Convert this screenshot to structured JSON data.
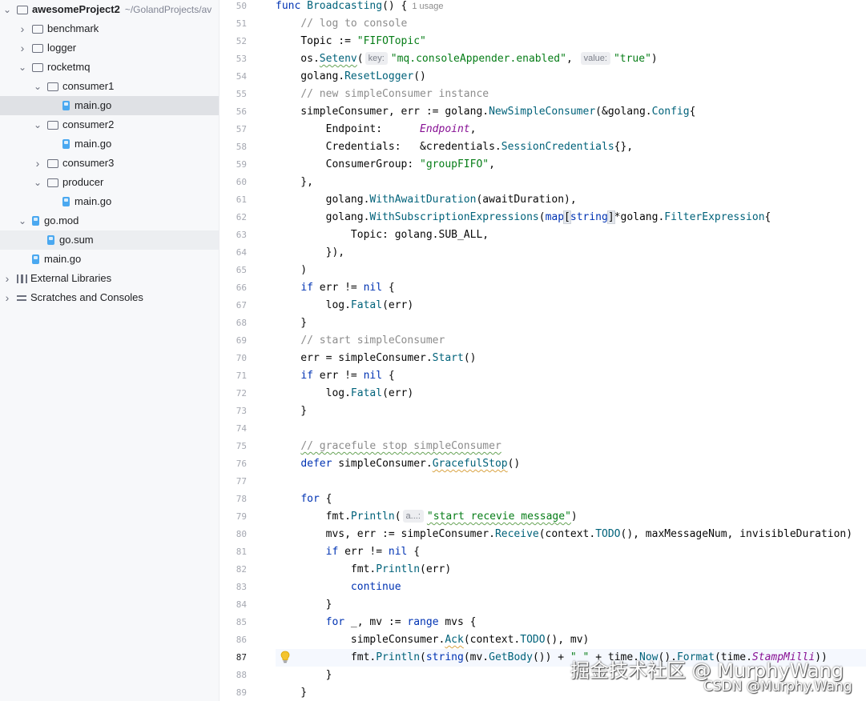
{
  "project": {
    "name": "awesomeProject2",
    "path": "~/GolandProjects/av",
    "tree": [
      {
        "label": "awesomeProject2",
        "kind": "root",
        "depth": 0,
        "expanded": true
      },
      {
        "label": "benchmark",
        "kind": "folder",
        "depth": 1,
        "expanded": false
      },
      {
        "label": "logger",
        "kind": "folder",
        "depth": 1,
        "expanded": false
      },
      {
        "label": "rocketmq",
        "kind": "folder",
        "depth": 1,
        "expanded": true
      },
      {
        "label": "consumer1",
        "kind": "folder",
        "depth": 2,
        "expanded": true
      },
      {
        "label": "main.go",
        "kind": "gofile",
        "depth": 3,
        "selected": true
      },
      {
        "label": "consumer2",
        "kind": "folder",
        "depth": 2,
        "expanded": true
      },
      {
        "label": "main.go",
        "kind": "gofile",
        "depth": 3
      },
      {
        "label": "consumer3",
        "kind": "folder",
        "depth": 2,
        "expanded": false
      },
      {
        "label": "producer",
        "kind": "folder",
        "depth": 2,
        "expanded": true
      },
      {
        "label": "main.go",
        "kind": "gofile",
        "depth": 3
      },
      {
        "label": "go.mod",
        "kind": "gomod",
        "depth": 1,
        "expanded": true
      },
      {
        "label": "go.sum",
        "kind": "gofile",
        "depth": 2
      },
      {
        "label": "main.go",
        "kind": "gofile",
        "depth": 1
      },
      {
        "label": "External Libraries",
        "kind": "lib",
        "depth": 0,
        "expanded": false
      },
      {
        "label": "Scratches and Consoles",
        "kind": "scratch",
        "depth": 0,
        "expanded": false
      }
    ]
  },
  "editor": {
    "current_line": 87,
    "usage_hint": "1 usage",
    "line_numbers": [
      "50",
      "51",
      "52",
      "53",
      "54",
      "55",
      "56",
      "57",
      "58",
      "59",
      "60",
      "61",
      "62",
      "63",
      "64",
      "65",
      "66",
      "67",
      "68",
      "69",
      "70",
      "71",
      "72",
      "73",
      "74",
      "75",
      "76",
      "77",
      "78",
      "79",
      "80",
      "81",
      "82",
      "83",
      "84",
      "85",
      "86",
      "87",
      "88",
      "89"
    ],
    "hints": {
      "key": "key:",
      "value": "value:",
      "a": "a...:"
    },
    "strings": {
      "fifo_topic": "\"FIFOTopic\"",
      "console_appender": "\"mq.consoleAppender.enabled\"",
      "true": "\"true\"",
      "group_fifo": "\"groupFIFO\"",
      "start_receive": "\"start recevie message\"",
      "sep": "\" \""
    },
    "comments": {
      "log": "// log to console",
      "new": "// new simpleConsumer instance",
      "start": "// start simpleConsumer",
      "graceful": "// gracefule stop simpleConsumer"
    }
  },
  "watermark": {
    "line1": "掘金技术社区 @ MurphyWang",
    "line2": "CSDN @Murphy.Wang"
  }
}
